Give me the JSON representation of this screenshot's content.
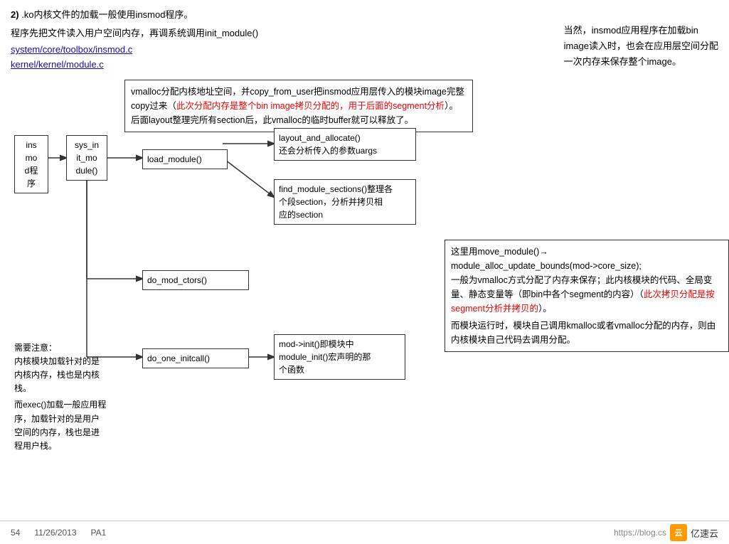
{
  "header": {
    "title_num": "2)",
    "title_text": " .ko内核文件的加载一般使用insmod程序。",
    "subtitle": "程序先把文件读入用户空间内存，再调系统调用init_module()",
    "link1": "system/core/toolbox/insmod.c",
    "link2": "kernel/kernel/module.c",
    "right_text": "当然，insmod应用程序在加载bin\nimage读入时，也会在应用层空间分配\n一次内存来保存整个image。"
  },
  "diagram": {
    "desc_top": {
      "text_normal1": "vmalloc分配内核地址空间，并copy_from_user把insmod应用层传入的模块image完整copy过来（",
      "text_red": "此次分配内存是整个bin image拷贝分配的，用于后面的segment分析",
      "text_normal2": "）。后面layout整理完所有section后，此vmalloc的临时buffer就可以释放了。"
    },
    "box_insmod": {
      "lines": [
        "ins",
        "mo",
        "d程",
        "序"
      ]
    },
    "box_sys_init": {
      "lines": [
        "sys_in",
        "it_mo",
        "dule()"
      ]
    },
    "box_load_module": {
      "text": "load_module()"
    },
    "box_layout": {
      "line1": "layout_and_allocate()",
      "line2": "还会分析传入的参数uargs"
    },
    "box_find_module": {
      "line1": "find_module_sections()整理各",
      "line2": "个段section，分析并拷贝相",
      "line3": "应的section"
    },
    "box_do_mod": {
      "text": "do_mod_ctors()"
    },
    "box_do_one": {
      "text": "do_one_initcall()"
    },
    "box_mod_init": {
      "line1": "mod->init()即模块中",
      "line2": "module_init()宏声明的那",
      "line3": "个函数"
    },
    "desc_right": {
      "text1": "这里用move_module()→",
      "text2": "module_alloc_update_bounds(mod->core_size);",
      "text3": "一般为vmalloc方式分配了内存来保存；此内核模块的代码、全局变量、静态变量等（即bin中各个segment的内容）（",
      "text_red": "此次拷贝分配是按segment分析并拷贝的",
      "text4": "）。\n而模块运行时，模块自己调用kmalloc或者vmalloc分配的内存，则由内核模块自己代码去调用分配。"
    },
    "note_left": {
      "line1": "需要注意：",
      "line2": "内核模块加载针对的是",
      "line3": "内核内存，栈也是内核",
      "line4": "栈。",
      "line5": "而exec()加载一般应用程",
      "line6": "序，加载针对的是用户",
      "line7": "空间的内存，栈也是进",
      "line8": "程用户栈。"
    }
  },
  "footer": {
    "page": "54",
    "date": "11/26/2013",
    "label": "PA1",
    "url": "https://blog.cs",
    "logo_text": "亿速云"
  }
}
